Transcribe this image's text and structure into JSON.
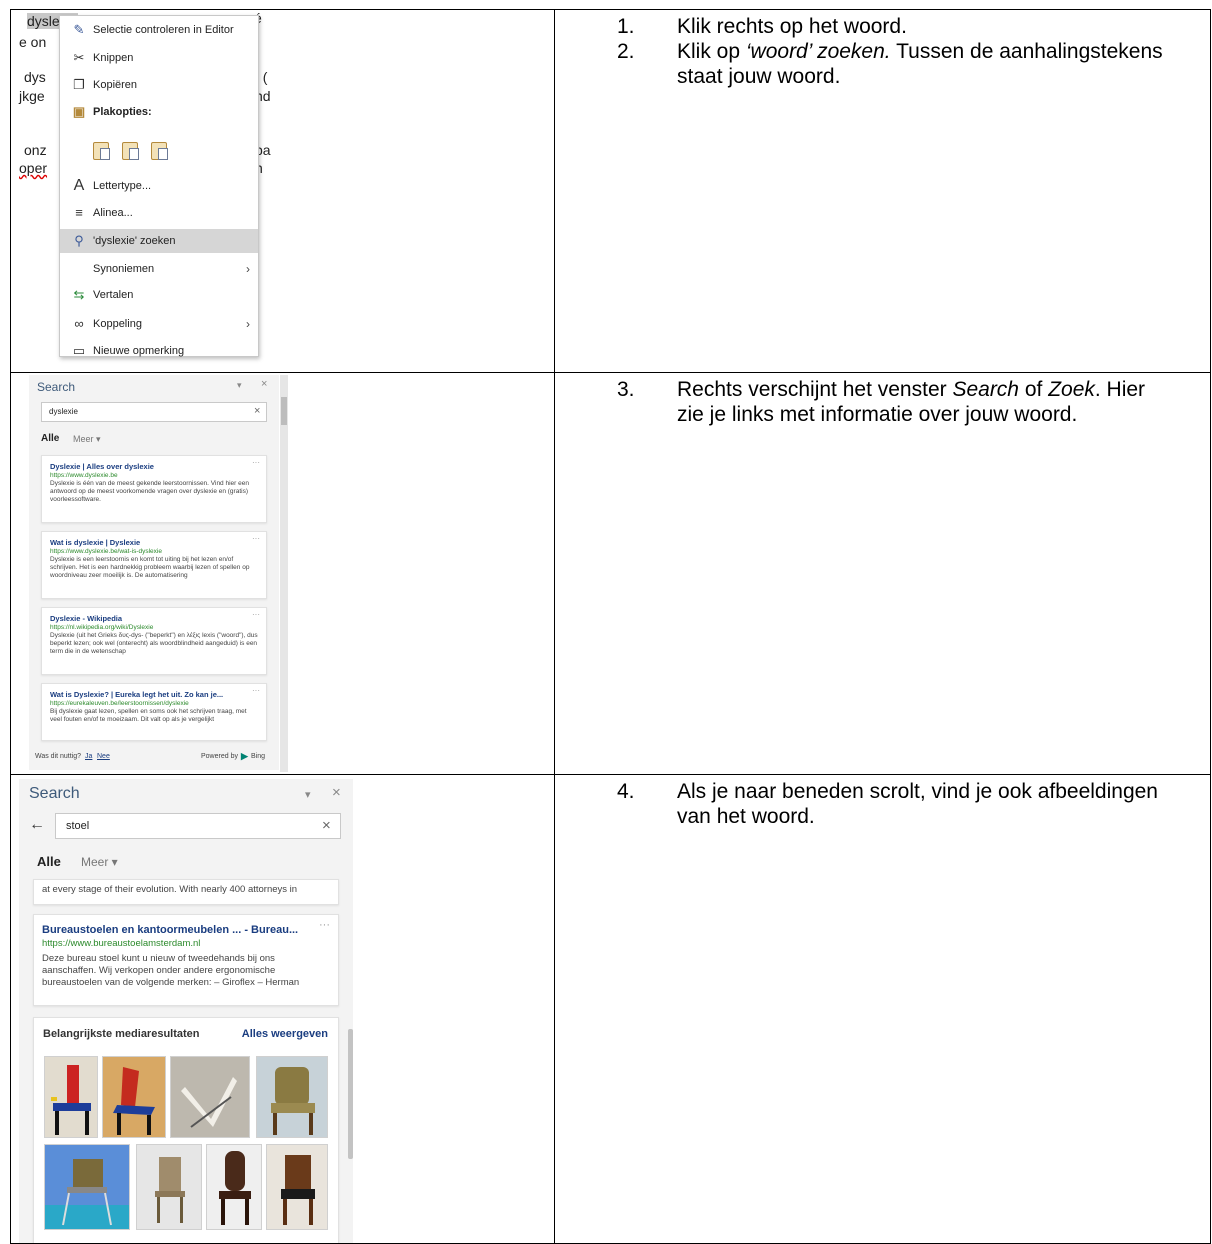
{
  "rows": [
    {
      "steps": [
        {
          "num": "1.",
          "parts": [
            {
              "t": "Klik rechts op het woord.",
              "i": false
            }
          ]
        },
        {
          "num": "2.",
          "parts": [
            {
              "t": "Klik op ",
              "i": false
            },
            {
              "t": "‘woord’ zoeken.",
              "i": true
            },
            {
              "t": " Tussen de aanhalingstekens staat jouw woord.",
              "i": false
            }
          ]
        }
      ]
    },
    {
      "steps": [
        {
          "num": "3.",
          "parts": [
            {
              "t": "Rechts verschijnt het venster ",
              "i": false
            },
            {
              "t": "Search",
              "i": true
            },
            {
              "t": " of ",
              "i": false
            },
            {
              "t": "Zoek",
              "i": true
            },
            {
              "t": ". Hier zie je links met informatie over jouw woord.",
              "i": false
            }
          ]
        }
      ]
    },
    {
      "steps": [
        {
          "num": "4.",
          "parts": [
            {
              "t": "Als je naar beneden scrolt, vind je ook afbeeldingen van het woord.",
              "i": false
            }
          ]
        }
      ]
    }
  ],
  "shot1": {
    "bg_lines": [
      "dyslexie",
      "é",
      "e on",
      "dys",
      ". (",
      "jkge",
      "nd",
      "onz",
      "pa",
      "oper",
      "n"
    ],
    "menu": {
      "check": "Selectie controleren in Editor",
      "cut": "Knippen",
      "copy": "Kopiëren",
      "paste_header": "Plakopties:",
      "font": "Lettertype...",
      "paragraph": "Alinea...",
      "search": "'dyslexie' zoeken",
      "synonyms": "Synoniemen",
      "translate": "Vertalen",
      "link": "Koppeling",
      "comment": "Nieuwe opmerking"
    }
  },
  "pane_small": {
    "title": "Search",
    "query": "dyslexie",
    "tab_all": "Alle",
    "tab_more": "Meer",
    "results": [
      {
        "title": "Dyslexie | Alles over dyslexie",
        "url": "https://www.dyslexie.be",
        "desc": "Dyslexie is één van de meest gekende leerstoornissen. Vind hier een antwoord op de meest voorkomende vragen over dyslexie en (gratis) voorleessoftware."
      },
      {
        "title": "Wat is dyslexie | Dyslexie",
        "url": "https://www.dyslexie.be/wat-is-dyslexie",
        "desc": "Dyslexie is een leerstoornis en komt tot uiting bij het lezen en/of schrijven. Het is een hardnekkig probleem waarbij lezen of spellen op woordniveau zeer moeilijk is. De automatisering"
      },
      {
        "title": "Dyslexie - Wikipedia",
        "url": "https://nl.wikipedia.org/wiki/Dyslexie",
        "desc": "Dyslexie (uit het Grieks δυς-dys- (\"beperkt\") en λέξις lexis (\"woord\"), dus beperkt lezen; ook wel (onterecht) als woordblindheid aangeduid) is een term die in de wetenschap"
      },
      {
        "title": "Wat is Dyslexie? | Eureka legt het uit. Zo kan je...",
        "url": "https://eurekaleuven.be/leerstoornissen/dyslexie",
        "desc": "Bij dyslexie gaat lezen, spellen en soms ook het schrijven traag, met veel fouten en/of te moeizaam. Dit valt op als je vergelijkt"
      }
    ],
    "footer_q": "Was dit nuttig?",
    "footer_yes": "Ja",
    "footer_no": "Nee",
    "footer_powered": "Powered by",
    "footer_bing": "Bing"
  },
  "pane_large": {
    "title": "Search",
    "query": "stoel",
    "tab_all": "Alle",
    "tab_more": "Meer",
    "prev_snippet": "at every stage of their evolution. With nearly 400 attorneys in",
    "result": {
      "title": "Bureaustoelen en kantoormeubelen ... - Bureau...",
      "url": "https://www.bureaustoelamsterdam.nl",
      "desc": "Deze bureau stoel kunt u nieuw of tweedehands bij ons aanschaffen. Wij verkopen onder andere ergonomische bureaustoelen van de volgende merken: – Giroflex – Herman"
    },
    "media_header": "Belangrijkste mediaresultaten",
    "media_all": "Alles weergeven"
  },
  "colors": {
    "link_blue": "#1a3d80",
    "url_green": "#2c8a2c",
    "pane_bg": "#f3f3f3",
    "highlight": "#d6d6d6"
  }
}
